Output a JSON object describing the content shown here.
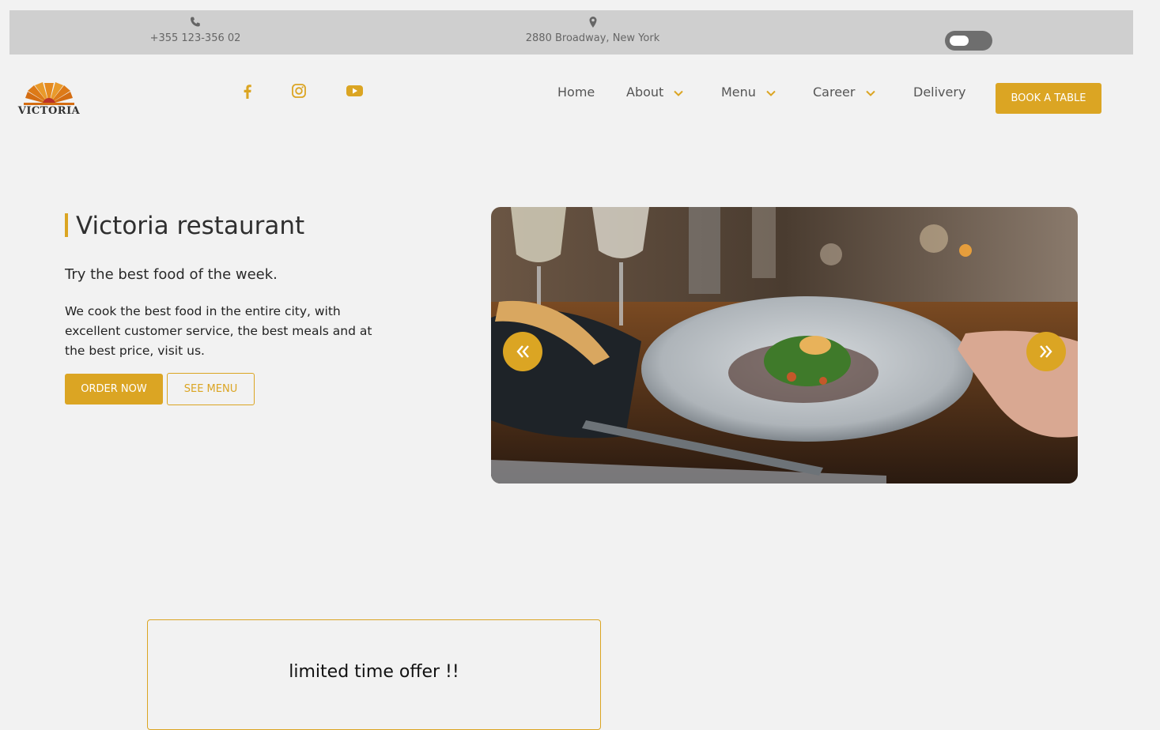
{
  "topbar": {
    "phone": "+355 123-356 02",
    "phone_icon": "phone-icon",
    "address": "2880 Broadway, New York",
    "address_icon": "map-pin-icon",
    "toggle_state": "off"
  },
  "header": {
    "logo_text": "VICTORIA",
    "social": [
      "facebook-icon",
      "instagram-icon",
      "youtube-icon"
    ],
    "nav": [
      {
        "label": "Home",
        "has_dropdown": false
      },
      {
        "label": "About",
        "has_dropdown": true
      },
      {
        "label": "Menu",
        "has_dropdown": true
      },
      {
        "label": "Career",
        "has_dropdown": true
      },
      {
        "label": "Delivery",
        "has_dropdown": false
      }
    ],
    "cta_label": "BOOK A TABLE"
  },
  "hero": {
    "title": "Victoria restaurant",
    "subtitle": "Try the best food of the week.",
    "description": "We cook the best food in the entire city, with excellent customer service, the best meals and at the best price, visit us.",
    "order_label": "ORDER NOW",
    "menu_label": "SEE MENU"
  },
  "carousel": {
    "prev_icon": "double-chevron-left-icon",
    "next_icon": "double-chevron-right-icon"
  },
  "offer": {
    "title": "limited time offer !!"
  },
  "colors": {
    "accent": "#dba523",
    "topbar_bg": "#cfcfcf",
    "page_bg": "#f2f2f2"
  }
}
